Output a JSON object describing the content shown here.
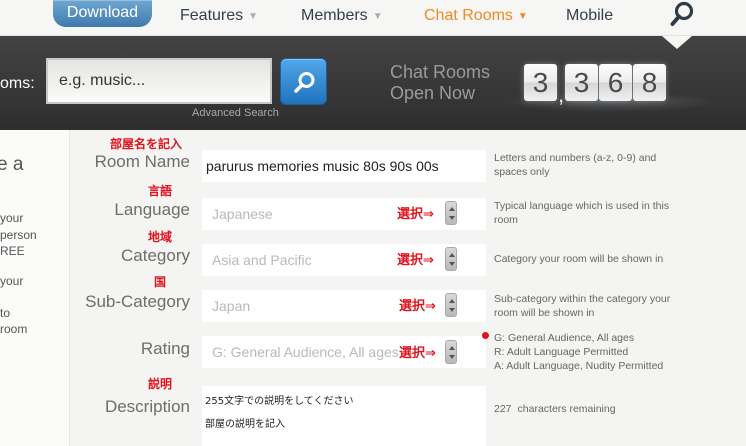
{
  "nav": {
    "download": "Download",
    "features": "Features",
    "members": "Members",
    "chat_rooms": "Chat Rooms",
    "mobile": "Mobile",
    "caret_glyph": "▼"
  },
  "search": {
    "label": "oms:",
    "placeholder": "e.g. music...",
    "advanced": "Advanced Search"
  },
  "stats": {
    "line1": "Chat Rooms",
    "line2": "Open Now",
    "digits": [
      "3",
      "3",
      "6",
      "8"
    ],
    "separator": ","
  },
  "left": {
    "heading": "e a",
    "lines": [
      "your",
      "person",
      "REE",
      "your",
      "to",
      "room"
    ]
  },
  "form": {
    "room_name": {
      "note": "部屋名を記入",
      "label": "Room Name",
      "value": "parurus memories music 80s 90s 00s",
      "hint": [
        "Letters and numbers (a-z, 0-9) and",
        "spaces only"
      ]
    },
    "language": {
      "note": "言語",
      "label": "Language",
      "placeholder": "Japanese",
      "select_note": "選択⇒",
      "hint": [
        "Typical language which is used in this",
        "room"
      ]
    },
    "category": {
      "note": "地域",
      "label": "Category",
      "placeholder": "Asia and Pacific",
      "select_note": "選択⇒",
      "hint": [
        "Category your room will be shown in"
      ]
    },
    "sub_category": {
      "note": "国",
      "label": "Sub-Category",
      "placeholder": "Japan",
      "select_note": "選択⇒",
      "hint": [
        "Sub-category within the category your",
        "room will be shown in"
      ]
    },
    "rating": {
      "label": "Rating",
      "placeholder": "G: General Audience, All ages",
      "select_note": "選択⇒",
      "options": [
        "G: General Audience, All ages",
        "R: Adult Language Permitted",
        "A: Adult Language, Nudity Permitted"
      ]
    },
    "description": {
      "note": "説明",
      "label": "Description",
      "lines": [
        "255文字での説明をしてください",
        "部屋の説明を記入"
      ],
      "chars_count": "227",
      "chars_text": "characters remaining"
    }
  },
  "colors": {
    "accent_orange": "#f08a24",
    "note_red": "#e0141f",
    "button_blue": "#1f72bd"
  }
}
